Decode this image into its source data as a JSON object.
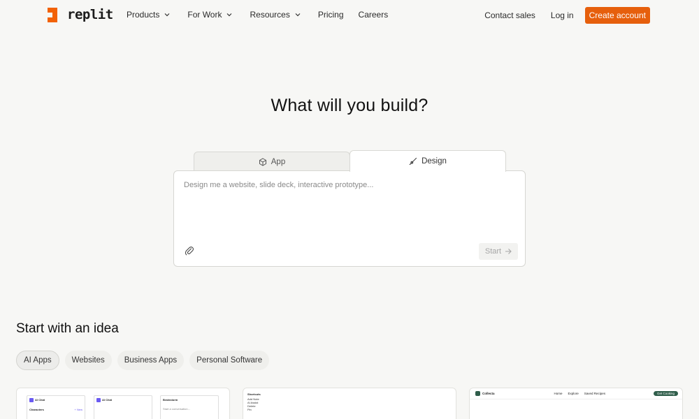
{
  "brand": {
    "name": "replit",
    "accent": "#f26207"
  },
  "nav": {
    "items": [
      {
        "label": "Products",
        "dropdown": true
      },
      {
        "label": "For Work",
        "dropdown": true
      },
      {
        "label": "Resources",
        "dropdown": true
      },
      {
        "label": "Pricing",
        "dropdown": false
      },
      {
        "label": "Careers",
        "dropdown": false
      }
    ],
    "contact": "Contact sales",
    "login": "Log in",
    "create": "Create account"
  },
  "hero": {
    "title": "What will you build?"
  },
  "tabs": [
    {
      "label": "App",
      "icon": "cube-icon",
      "active": false
    },
    {
      "label": "Design",
      "icon": "brush-icon",
      "active": true
    }
  ],
  "prompt": {
    "placeholder": "Design me a website, slide deck, interactive prototype...",
    "start": "Start"
  },
  "ideas": {
    "title": "Start with an idea",
    "pills": [
      "AI Apps",
      "Websites",
      "Business Apps",
      "Personal Software"
    ],
    "active": "AI Apps"
  },
  "cards": {
    "card1": {
      "a": "AI Chat",
      "b": "AI Chat",
      "c": "Characters",
      "d": "+ New",
      "e": "Brainstorm",
      "f": "Start a conversation..."
    },
    "card2": {
      "title": "Shortcuts",
      "rows": [
        "Add Note",
        "AI Assist",
        "Delete",
        "Pin"
      ]
    },
    "card3": {
      "brand": "Collecta",
      "links": [
        "Home",
        "Explore",
        "Saved Recipes"
      ],
      "cta": "Get Cooking"
    }
  }
}
